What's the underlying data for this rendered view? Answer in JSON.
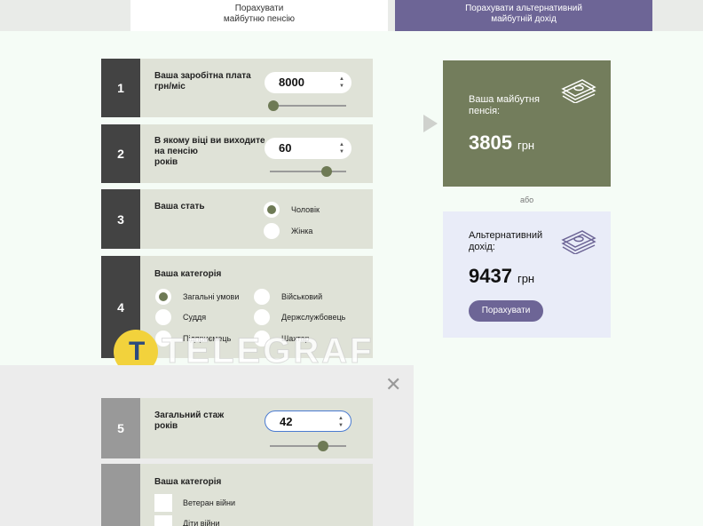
{
  "tabs": {
    "future_pension": "Порахувати\nмайбутню пенсію",
    "alternative_income": "Порахувати альтернативний\nмайбутній дохід"
  },
  "step1": {
    "number": "1",
    "label": "Ваша заробітна плата\nгрн/міс",
    "value": "8000",
    "slider_fraction": 0.0
  },
  "step2": {
    "number": "2",
    "label": "В якому віці ви виходите\nна пенсію\nроків",
    "value": "60",
    "slider_fraction": 0.75
  },
  "step3": {
    "number": "3",
    "label": "Ваша стать",
    "options": [
      "Чоловік",
      "Жінка"
    ],
    "selected": "Чоловік"
  },
  "step4": {
    "number": "4",
    "label": "Ваша категорія",
    "options": [
      "Загальні умови",
      "Військовий",
      "Суддя",
      "Держслужбовець",
      "Підприємець",
      "Шахтар"
    ],
    "selected": "Загальні умови"
  },
  "step5": {
    "number": "5",
    "label": "Загальний стаж\nроків",
    "value": "42",
    "slider_fraction": 0.7
  },
  "step6": {
    "label": "Ваша категорія",
    "options": [
      "Ветеран війни",
      "Діти війни"
    ]
  },
  "result_pension": {
    "title": "Ваша майбутня\nпенсія:",
    "value": "3805",
    "unit": "грн"
  },
  "or_text": "або",
  "result_alternative": {
    "title": "Альтернативний\nдохід:",
    "value": "9437",
    "unit": "грн",
    "button": "Порахувати"
  },
  "watermark": "TELEGRAF",
  "colors": {
    "olive": "#737d5c",
    "purple": "#6d6596",
    "card": "#dfe2d7",
    "dark": "#434343"
  }
}
